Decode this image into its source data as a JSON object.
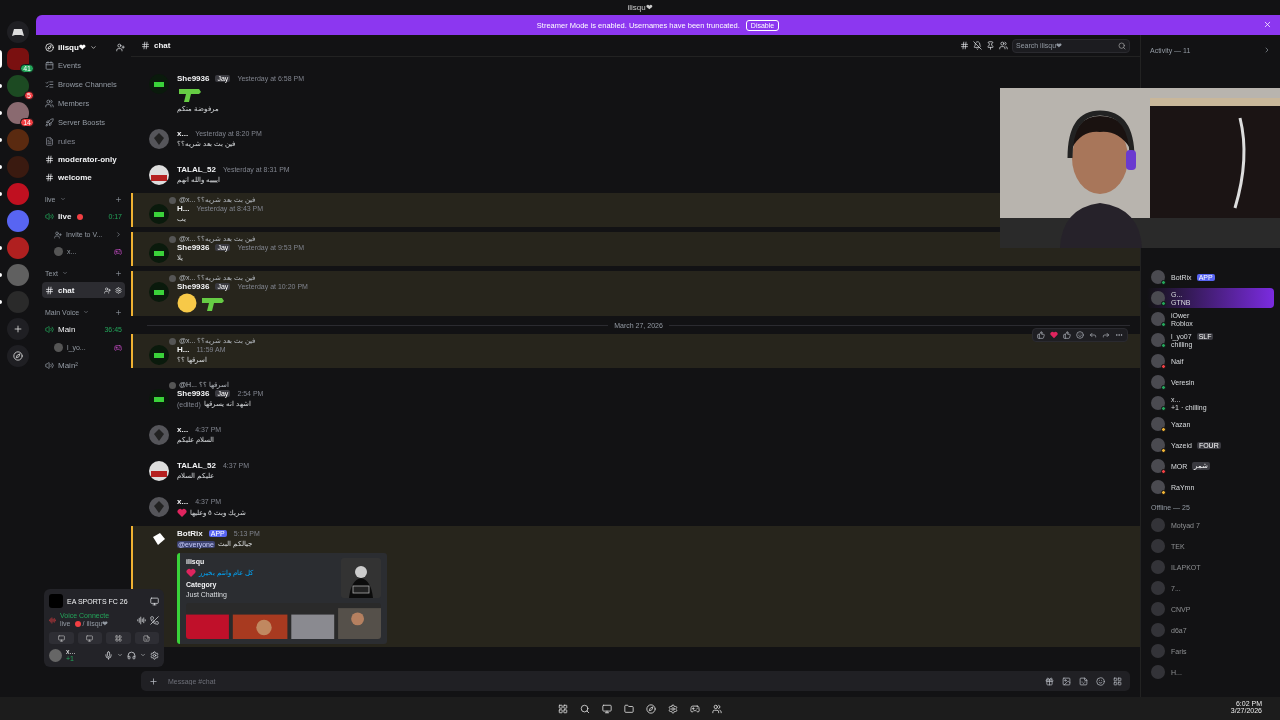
{
  "window": {
    "title": "ilisqu❤"
  },
  "servers": [
    {
      "selected": true,
      "badge": "41",
      "color": "#7a1010"
    },
    {
      "selected": false,
      "unread": true,
      "badge": "5",
      "color": "#1c4a22"
    },
    {
      "selected": false,
      "unread": true,
      "badge": "14",
      "color": "#8a6a70"
    },
    {
      "selected": false,
      "unread": true,
      "color": "#5a2a10"
    },
    {
      "selected": false,
      "unread": true,
      "color": "#3a1a10"
    },
    {
      "selected": false,
      "unread": true,
      "color": "#c01020"
    },
    {
      "selected": false,
      "color": "#5865f2"
    },
    {
      "selected": false,
      "unread": true,
      "color": "#b02020"
    },
    {
      "selected": false,
      "unread": true,
      "color": "#606060"
    },
    {
      "selected": false,
      "unread": true,
      "color": "#2a2a2a"
    }
  ],
  "banner": {
    "text": "Streamer Mode is enabled. Usernames have been truncated.",
    "button": "Disable"
  },
  "server_name": "ilisqu❤",
  "channels": [
    {
      "kind": "nav",
      "label": "Events"
    },
    {
      "kind": "nav",
      "label": "Browse Channels"
    },
    {
      "kind": "nav",
      "label": "Members"
    },
    {
      "kind": "nav",
      "label": "Server Boosts"
    },
    {
      "kind": "rules",
      "label": "rules",
      "unread": false,
      "selected": false
    },
    {
      "kind": "text",
      "label": "moderator-only",
      "unread": true,
      "selected": false
    },
    {
      "kind": "text",
      "label": "welcome",
      "unread": true,
      "selected": false
    },
    {
      "kind": "category",
      "label": "live"
    },
    {
      "kind": "voice",
      "label": "live",
      "live": true,
      "time": "0:17"
    },
    {
      "kind": "invite",
      "label": "Invite to V..."
    },
    {
      "kind": "voice-user",
      "label": "x..."
    },
    {
      "kind": "category",
      "label": "Text"
    },
    {
      "kind": "text",
      "label": "chat",
      "unread": true,
      "selected": true
    },
    {
      "kind": "category",
      "label": "Main Voice"
    },
    {
      "kind": "voice",
      "label": "Main",
      "live": false,
      "time": "36:45"
    },
    {
      "kind": "voice-user",
      "label": "l_yo..."
    },
    {
      "kind": "voice",
      "label": "Main²",
      "live": false
    }
  ],
  "activity_panel": {
    "game": "EA SPORTS FC 26",
    "status": "Voice Connecte",
    "channel": "live",
    "separator": "/",
    "server": "ilisqu❤"
  },
  "user_panel": {
    "name": "x...",
    "status": "+1"
  },
  "chat": {
    "channel": "chat",
    "search_placeholder": "Search ilisqu❤",
    "input_placeholder": "Message #chat",
    "date_divider": "March 27, 2026"
  },
  "messages": [
    {
      "kind": "logo",
      "author": "She9936",
      "tag": "Jay",
      "time": "Yesterday at 6:58 PM",
      "highlighted": false,
      "lines": [
        [
          {
            "kind": "gun"
          }
        ],
        [
          {
            "kind": "text",
            "text": "مرفوضة منكم"
          }
        ]
      ]
    },
    {
      "kind": "default",
      "author": "x...",
      "time": "Yesterday at 8:20 PM",
      "highlighted": false,
      "lines": [
        [
          {
            "kind": "text",
            "text": "فين بث بعد شريه؟؟"
          }
        ]
      ]
    },
    {
      "author": "TALAL_52",
      "time": "Yesterday at 8:31 PM",
      "highlighted": false,
      "lines": [
        [
          {
            "kind": "text",
            "text": "اييييه والله انهم"
          }
        ]
      ]
    },
    {
      "kind": "logo",
      "author": "H...",
      "time": "Yesterday at 8:43 PM",
      "highlighted": true,
      "reply": {
        "author": "@x...",
        "text": "فين بث بعد شريه؟؟"
      },
      "lines": [
        [
          {
            "kind": "text",
            "text": "يب"
          }
        ]
      ]
    },
    {
      "kind": "logo",
      "author": "She9936",
      "tag": "Jay",
      "time": "Yesterday at 9:53 PM",
      "highlighted": true,
      "reply": {
        "author": "@x...",
        "text": "فين بث بعد شريه؟؟"
      },
      "lines": [
        [
          {
            "kind": "text",
            "text": "يلا"
          }
        ]
      ]
    },
    {
      "kind": "logo",
      "author": "She9936",
      "tag": "Jay",
      "time": "Yesterday at 10:20 PM",
      "highlighted": true,
      "reply": {
        "author": "@x...",
        "text": "فين بث بعد شريه؟؟"
      },
      "lines": [
        [
          {
            "kind": "face"
          },
          {
            "kind": "gun"
          }
        ]
      ]
    },
    {
      "kind": "divider"
    },
    {
      "kind": "logo",
      "author": "H...",
      "time": "11:59 AM",
      "highlighted": true,
      "hovered": true,
      "reply": {
        "author": "@x...",
        "text": "فين بث بعد شريه؟؟"
      },
      "lines": [
        [
          {
            "kind": "text",
            "text": "اسرقها ؟؟"
          }
        ]
      ]
    },
    {
      "kind": "logo",
      "author": "She9936",
      "tag": "Jay",
      "time": "2:54 PM",
      "highlighted": false,
      "reply": {
        "author": "@H...",
        "text": "اسرقها ؟؟"
      },
      "lines": [
        [
          {
            "kind": "edited",
            "text": "(edited)"
          },
          {
            "kind": "text",
            "text": "اشهد انه يسرقها"
          }
        ]
      ]
    },
    {
      "kind": "default",
      "author": "x...",
      "time": "4:37 PM",
      "highlighted": false,
      "lines": [
        [
          {
            "kind": "text",
            "text": "السلام عليكم"
          }
        ]
      ]
    },
    {
      "author": "TALAL_52",
      "time": "4:37 PM",
      "highlighted": false,
      "lines": [
        [
          {
            "kind": "text",
            "text": "عليكم السلام"
          }
        ]
      ]
    },
    {
      "kind": "default",
      "author": "x...",
      "time": "4:37 PM",
      "highlighted": false,
      "lines": [
        [
          {
            "kind": "heart"
          },
          {
            "kind": "text",
            "text": "شريك وبث ٥ وعليها"
          }
        ]
      ]
    },
    {
      "kind": "bot",
      "author": "BotRix",
      "tag": "APP",
      "time": "5:13 PM",
      "highlighted": true,
      "lines": [
        [
          {
            "kind": "mention",
            "text": "@everyone"
          },
          {
            "kind": "text",
            "text": "جيالكم البث"
          }
        ]
      ],
      "embed": {
        "title": "ilisqu",
        "description": "كل عام وانتم بخيرر",
        "field_name": "Category",
        "field_value": "Just Chatting"
      }
    }
  ],
  "members": {
    "activity": "Activity — 11",
    "list": [
      {
        "name": "BotRix",
        "tag": "APP",
        "color": "#23a55a",
        "highlighted": false
      },
      {
        "name": "G...",
        "sub": "GTNB",
        "color": "#23a55a",
        "highlighted": true
      },
      {
        "name": "iOwer",
        "sub": "Roblox",
        "color": "#23a55a",
        "highlighted": false
      },
      {
        "name": "l_yo07",
        "tag": "SLF",
        "sub": "chilling",
        "color": "#23a55a",
        "highlighted": false
      },
      {
        "name": "Naif",
        "color": "#f23f43",
        "highlighted": false
      },
      {
        "name": "Veresin",
        "color": "#23a55a",
        "highlighted": false
      },
      {
        "name": "x...",
        "sub": "+1 · chilling",
        "color": "#23a55a",
        "highlighted": false
      },
      {
        "name": "Yazan",
        "color": "#f0b232",
        "highlighted": false
      },
      {
        "name": "Yazeid",
        "tag": "FOUR",
        "color": "#f0b232",
        "highlighted": false
      },
      {
        "name": "MOR",
        "tag": "شمر",
        "color": "#f23f43",
        "highlighted": false
      },
      {
        "name": "RaYmn",
        "color": "#f0b232",
        "highlighted": false
      }
    ],
    "offline": "Offline — 25",
    "offline_list": [
      {
        "name": "Motyad 7"
      },
      {
        "name": "TEK"
      },
      {
        "name": "ILAPKOT"
      },
      {
        "name": "7..."
      },
      {
        "name": "CNVP"
      },
      {
        "name": "d6a7"
      },
      {
        "name": "Faris"
      },
      {
        "name": "H..."
      }
    ]
  },
  "taskbar": {
    "time": "6:02 PM",
    "date": "3/27/2026"
  }
}
